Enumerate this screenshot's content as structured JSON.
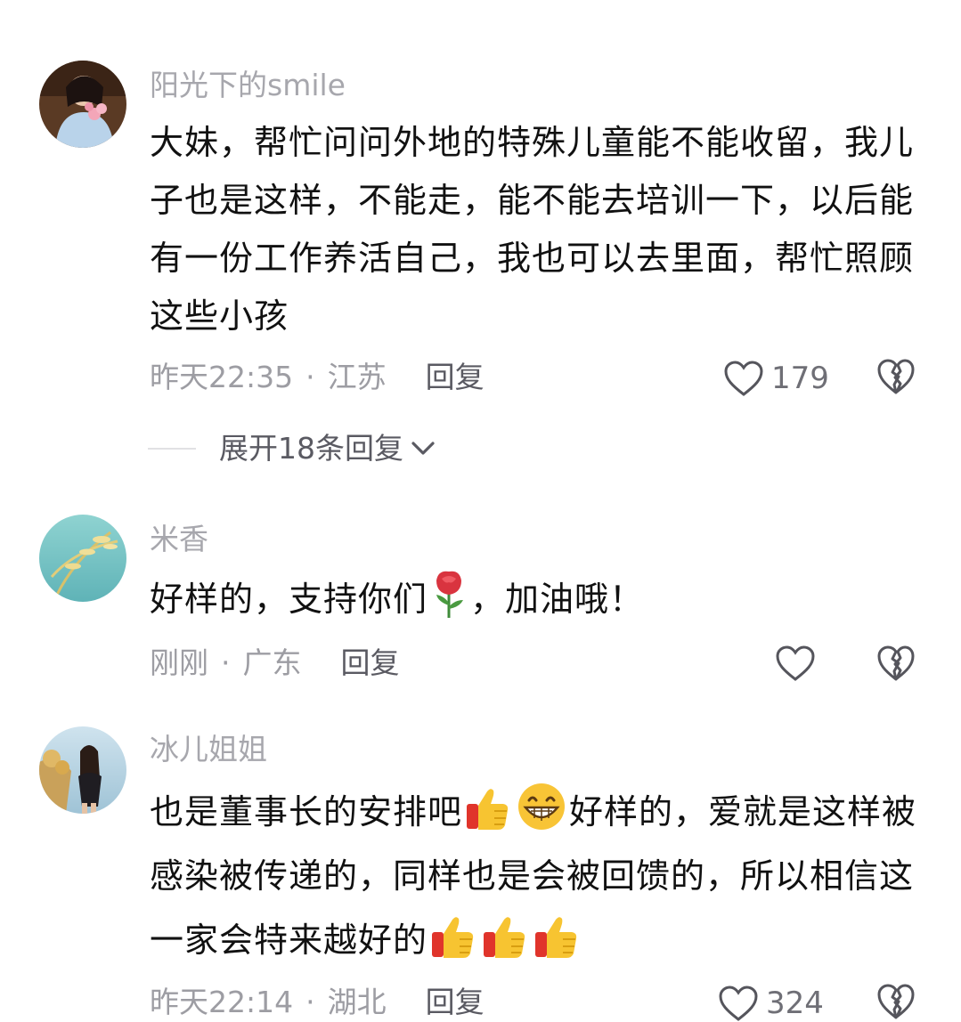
{
  "comments": [
    {
      "username": "阳光下的smile",
      "text": "大妹，帮忙问问外地的特殊儿童能不能收留，我儿子也是这样，不能走，能不能去培训一下，以后能有一份工作养活自己，我也可以去里面，帮忙照顾这些小孩",
      "time": "昨天22:35",
      "location": "江苏",
      "reply_label": "回复",
      "likes": "179",
      "expand_label": "展开18条回复"
    },
    {
      "username": "米香",
      "text_before": "好样的，支持你们",
      "text_after": "，加油哦！",
      "time": "刚刚",
      "location": "广东",
      "reply_label": "回复"
    },
    {
      "username": "冰儿姐姐",
      "text_part1": "也是董事长的安排吧",
      "text_part2": "好样的，爱就是这样被感染被传递的，同样也是会被回馈的，所以相信这一家会特来越好的",
      "time": "昨天22:14",
      "location": "湖北",
      "reply_label": "回复",
      "likes": "324"
    }
  ],
  "separator": "·",
  "icons": {
    "like": "heart-outline-icon",
    "dislike": "broken-heart-icon",
    "expand": "chevron-down-icon",
    "rose": "rose-emoji",
    "thumbs_up": "thumbs-up-emoji",
    "grin": "grin-emoji"
  },
  "colors": {
    "username": "#a7a7ad",
    "body": "#111111",
    "meta": "#9d9da3",
    "reply": "#5a5a62"
  }
}
